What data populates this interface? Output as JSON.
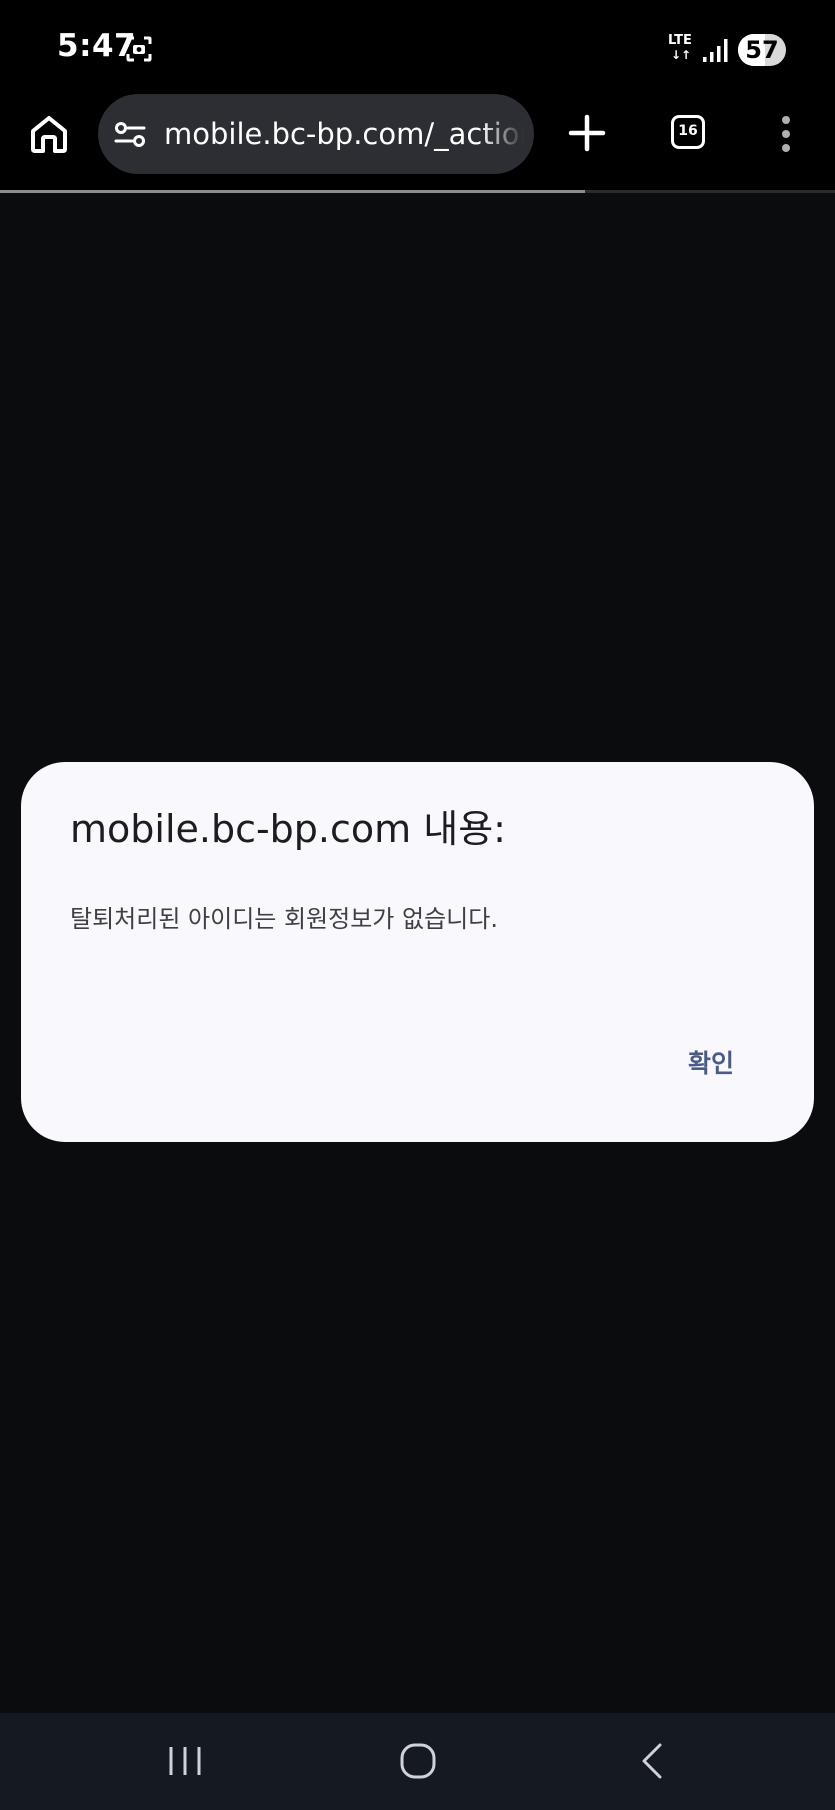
{
  "status_bar": {
    "time": "5:47",
    "network": "LTE",
    "network_arrows": "↓↑",
    "battery_level": "57",
    "battery_fraction": 0.57,
    "icons": [
      "screenshot-icon",
      "signal-icon",
      "battery-icon"
    ]
  },
  "browser": {
    "url": "mobile.bc-bp.com/_action",
    "tab_count": "16",
    "page_load_progress": 0.7,
    "icons": [
      "home-icon",
      "site-settings-icon",
      "plus-icon",
      "tab-switcher-icon",
      "more-vert-icon"
    ]
  },
  "dialog": {
    "title": "mobile.bc-bp.com 내용:",
    "message": "탈퇴처리된 아이디는 회원정보가 없습니다.",
    "confirm_label": "확인"
  },
  "nav_bar": {
    "icons": [
      "recents-icon",
      "home-nav-icon",
      "back-icon"
    ]
  },
  "colors": {
    "page_background": "#0b0c0e",
    "dialog_background": "#f8f8fd",
    "confirm_text": "#4b5b87",
    "url_bar": "#2c2e33",
    "nav_bar": "#151922"
  }
}
